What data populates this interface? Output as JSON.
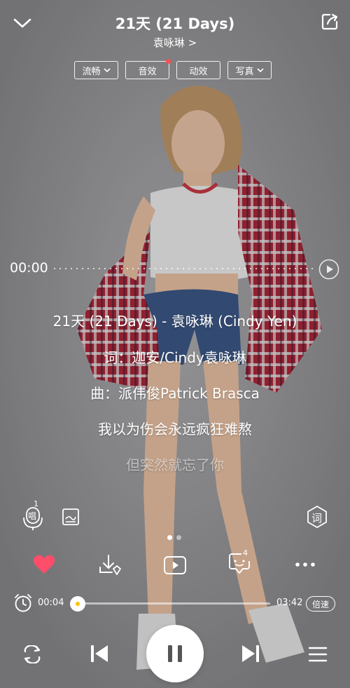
{
  "header": {
    "title": "21天 (21 Days)",
    "artist": "袁咏琳 >"
  },
  "chips": [
    {
      "label": "流畅",
      "dropdown": true,
      "dot": false
    },
    {
      "label": "音效",
      "dropdown": false,
      "dot": true
    },
    {
      "label": "动效",
      "dropdown": false,
      "dot": false
    },
    {
      "label": "写真",
      "dropdown": true,
      "dot": false
    }
  ],
  "lyric_time": "00:00",
  "lyrics": [
    {
      "text": "21天 (21 Days) - 袁咏琳 (Cindy Yen)",
      "dim": false
    },
    {
      "text": "词：迦安/Cindy袁咏琳",
      "dim": false
    },
    {
      "text": "曲：派伟俊Patrick Brasca",
      "dim": false
    },
    {
      "text": "我以为伤会永远疯狂难熬",
      "dim": false
    },
    {
      "text": "但突然就忘了你",
      "dim": true
    }
  ],
  "tools": {
    "sing_badge": "1",
    "sing_label": "唱",
    "lyric_label": "词"
  },
  "actions": {
    "comment_count": "4"
  },
  "playback": {
    "current_time": "00:04",
    "total_time": "03:42",
    "progress": 0.018,
    "speed_label": "倍速"
  },
  "colors": {
    "like": "#ff4d6a",
    "accent_knob": "#f5c400"
  }
}
